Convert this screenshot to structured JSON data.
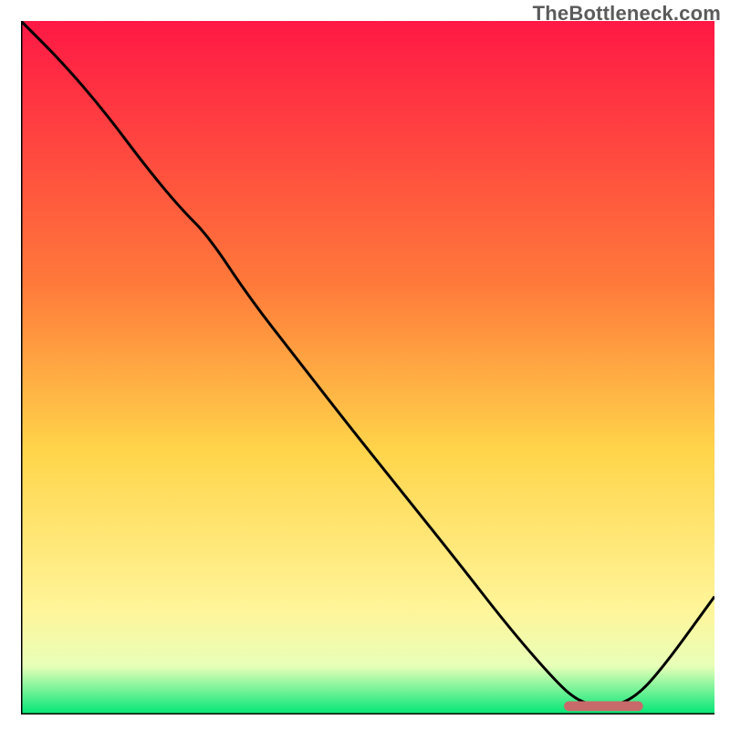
{
  "attribution": "TheBottleneck.com",
  "colors": {
    "grad_top": "#ff1845",
    "grad_mid_upper": "#ff7a3a",
    "grad_mid": "#ffd54a",
    "grad_lower": "#fff59a",
    "grad_pale": "#e8ffb8",
    "grad_green": "#00e676",
    "curve": "#000000",
    "marker": "#c96a6a",
    "axes": "#000000"
  },
  "chart_data": {
    "type": "line",
    "title": "",
    "xlabel": "",
    "ylabel": "",
    "xlim": [
      0,
      100
    ],
    "ylim": [
      0,
      100
    ],
    "series": [
      {
        "name": "bottleneck-curve",
        "x": [
          0,
          6,
          12,
          18,
          23,
          27,
          33,
          40,
          47,
          55,
          63,
          70,
          76,
          80,
          84,
          88,
          92,
          100
        ],
        "y": [
          100,
          94,
          87,
          79,
          73,
          69,
          60,
          51,
          42,
          32,
          22,
          13,
          6,
          2,
          1,
          2,
          6,
          17
        ]
      }
    ],
    "marker": {
      "name": "optimal-band",
      "x_start": 79,
      "x_end": 89,
      "y": 1.2,
      "thickness": 1.4
    },
    "gradient_stops": [
      {
        "offset": 0.0,
        "key": "grad_top"
      },
      {
        "offset": 0.38,
        "key": "grad_mid_upper"
      },
      {
        "offset": 0.62,
        "key": "grad_mid"
      },
      {
        "offset": 0.85,
        "key": "grad_lower"
      },
      {
        "offset": 0.93,
        "key": "grad_pale"
      },
      {
        "offset": 1.0,
        "key": "grad_green"
      }
    ]
  }
}
